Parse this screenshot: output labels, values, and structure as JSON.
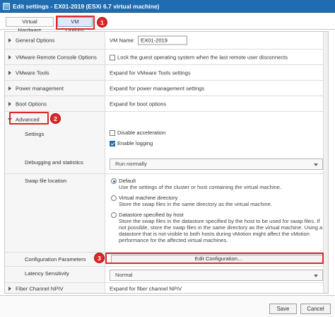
{
  "window": {
    "title": "Edit settings - EX01-2019 (ESXi 6.7 virtual machine)"
  },
  "tabs": [
    {
      "label": "Virtual Hardware"
    },
    {
      "label": "VM Options"
    }
  ],
  "callouts": [
    "1",
    "2",
    "3"
  ],
  "colors": {
    "accent": "#1f6cb0",
    "callout": "#e02727"
  },
  "sections": {
    "general": {
      "label": "General Options",
      "vm_name_label": "VM Name:",
      "vm_name_value": "EX01-2019"
    },
    "vmrc": {
      "label": "VMware Remote Console Options",
      "option": "Lock the guest operating system when the last remote user disconnects",
      "checked": false
    },
    "tools": {
      "label": "VMware Tools",
      "value": "Expand for VMware Tools settings"
    },
    "power": {
      "label": "Power management",
      "value": "Expand for power management settings"
    },
    "boot": {
      "label": "Boot Options",
      "value": "Expand for boot options"
    },
    "advanced": {
      "label": "Advanced",
      "settings": {
        "label": "Settings",
        "disable_acceleration": {
          "label": "Disable acceleration",
          "checked": false
        },
        "enable_logging": {
          "label": "Enable logging",
          "checked": true
        }
      },
      "debugging": {
        "label": "Debugging and statistics",
        "value": "Run normally"
      },
      "swap": {
        "label": "Swap file location",
        "options": [
          {
            "title": "Default",
            "desc": "Use the settings of the cluster or host containing the virtual machine.",
            "selected": true
          },
          {
            "title": "Virtual machine directory",
            "desc": "Store the swap files in the same directory as the virtual machine.",
            "selected": false
          },
          {
            "title": "Datastore specified by host",
            "desc": "Store the swap files in the datastore specified by the host to be used for swap files. If not possible, store the swap files in the same directory as the virtual machine. Using a datastore that is not visible to both hosts during vMotion might affect the vMotion performance for the affected virtual machines.",
            "selected": false
          }
        ]
      },
      "config": {
        "label": "Configuration Parameters",
        "button": "Edit Configuration..."
      },
      "latency": {
        "label": "Latency Sensitivity",
        "value": "Normal"
      }
    },
    "fc": {
      "label": "Fiber Channel NPIV",
      "value": "Expand for fiber channel NPIV"
    }
  },
  "footer": {
    "save": "Save",
    "cancel": "Cancel"
  }
}
